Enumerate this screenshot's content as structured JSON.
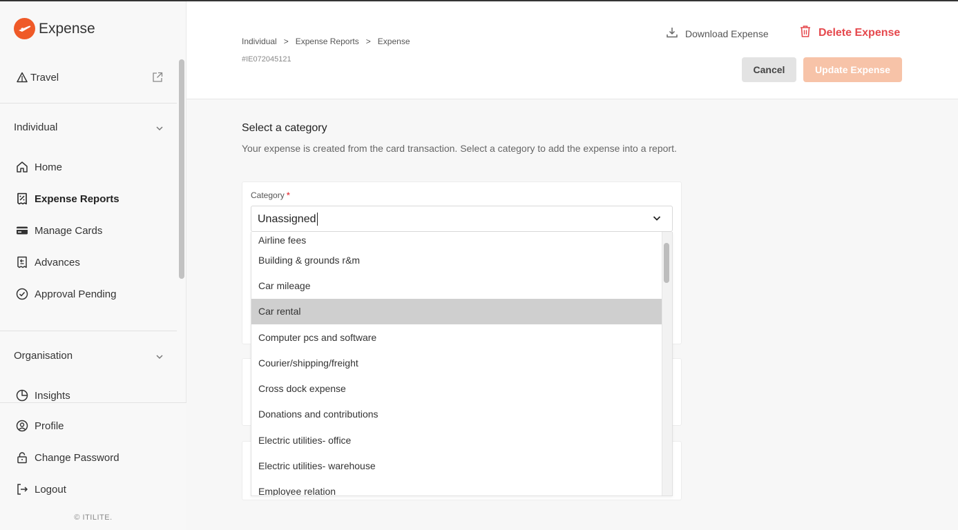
{
  "brand": {
    "name": "Expense",
    "accent": "#ef5a28"
  },
  "sidebar": {
    "travel": {
      "label": "Travel"
    },
    "individual": {
      "title": "Individual",
      "items": [
        {
          "label": "Home",
          "icon": "home-icon"
        },
        {
          "label": "Expense Reports",
          "icon": "receipt-icon",
          "active": true
        },
        {
          "label": "Manage Cards",
          "icon": "card-icon"
        },
        {
          "label": "Advances",
          "icon": "advance-icon"
        },
        {
          "label": "Approval Pending",
          "icon": "check-circle-icon"
        }
      ]
    },
    "organisation": {
      "title": "Organisation",
      "items": [
        {
          "label": "Insights",
          "icon": "pie-chart-icon"
        }
      ]
    },
    "bottom": [
      {
        "label": "Profile",
        "icon": "user-circle-icon"
      },
      {
        "label": "Change Password",
        "icon": "lock-icon"
      },
      {
        "label": "Logout",
        "icon": "logout-icon"
      }
    ],
    "copyright": "© ITILITE."
  },
  "header": {
    "breadcrumb": [
      "Individual",
      ">",
      "Expense Reports",
      ">",
      "Expense"
    ],
    "transaction_id": "#IE072045121",
    "download_label": "Download Expense",
    "delete_label": "Delete Expense",
    "cancel_label": "Cancel",
    "update_label": "Update Expense"
  },
  "main": {
    "title": "Select a category",
    "description": "Your expense is created from the card transaction. Select a category to add the expense into a report.",
    "category": {
      "label": "Category",
      "required_mark": "*",
      "value": "Unassigned",
      "options": [
        "Airline fees",
        "Building & grounds r&m",
        "Car mileage",
        "Car rental",
        "Computer pcs and software",
        "Courier/shipping/freight",
        "Cross dock expense",
        "Donations and contributions",
        "Electric utilities- office",
        "Electric utilities- warehouse",
        "Employee relation"
      ],
      "highlighted": "Car rental"
    }
  }
}
